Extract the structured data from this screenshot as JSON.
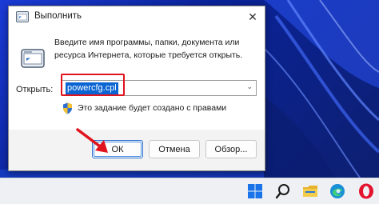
{
  "dialog": {
    "title": "Выполнить",
    "close_glyph": "✕",
    "description": "Введите имя программы, папки, документа или ресурса Интернета, которые требуется открыть.",
    "open_label": "Открыть:",
    "open_value": "powercfg.cpl",
    "admin_note": "Это задание будет создано с правами",
    "buttons": {
      "ok": "ОК",
      "cancel": "Отмена",
      "browse": "Обзор..."
    }
  },
  "annotation": {
    "color": "#e0141e"
  },
  "taskbar": {
    "icons": [
      "windows-start-icon",
      "search-icon",
      "file-explorer-icon",
      "edge-icon",
      "opera-icon"
    ]
  },
  "colors": {
    "selection": "#0a64d2",
    "accent": "#2c6fcf"
  }
}
